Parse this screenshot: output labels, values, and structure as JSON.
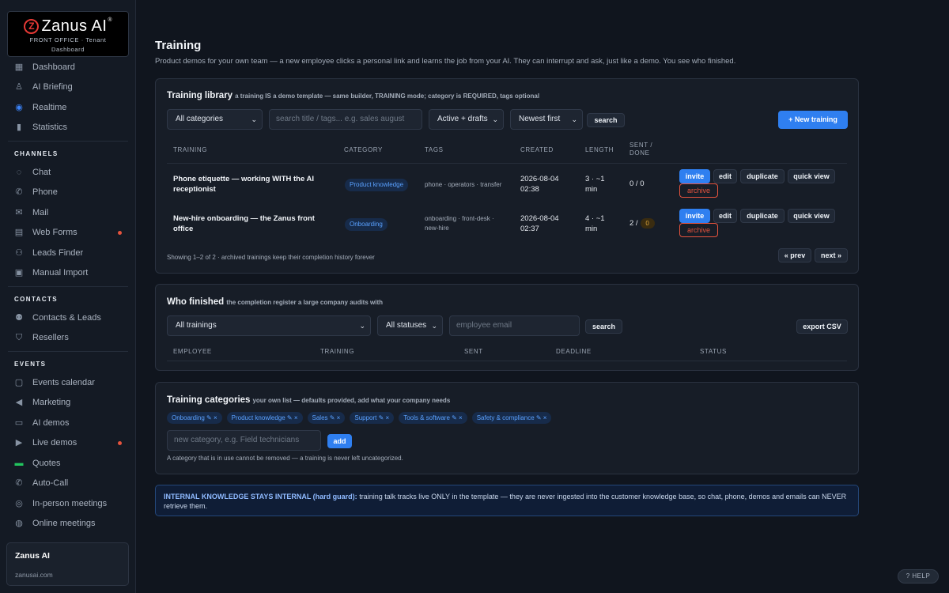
{
  "brand": {
    "logo_letter": "Z",
    "logo_text": "Zanus AI",
    "logo_reg": "®",
    "subtitle_line1": "FRONT OFFICE · Tenant",
    "subtitle_line2": "Dashboard"
  },
  "sidebar": {
    "top_items": [
      {
        "label": "Dashboard",
        "icon": "grid-icon"
      },
      {
        "label": "AI Briefing",
        "icon": "person-wave-icon"
      },
      {
        "label": "Realtime",
        "icon": "globe-icon"
      },
      {
        "label": "Statistics",
        "icon": "bar-chart-icon"
      }
    ],
    "channels_heading": "CHANNELS",
    "channels": [
      {
        "label": "Chat",
        "icon": "chat-bubble-icon"
      },
      {
        "label": "Phone",
        "icon": "phone-icon"
      },
      {
        "label": "Mail",
        "icon": "mail-icon"
      },
      {
        "label": "Web Forms",
        "icon": "form-icon",
        "dot": true
      },
      {
        "label": "Leads Finder",
        "icon": "people-icon"
      },
      {
        "label": "Manual Import",
        "icon": "import-icon"
      }
    ],
    "contacts_heading": "CONTACTS",
    "contacts": [
      {
        "label": "Contacts & Leads",
        "icon": "contacts-icon"
      },
      {
        "label": "Resellers",
        "icon": "handshake-icon"
      }
    ],
    "events_heading": "EVENTS",
    "events": [
      {
        "label": "Events calendar",
        "icon": "calendar-icon"
      },
      {
        "label": "Marketing",
        "icon": "megaphone-icon"
      },
      {
        "label": "AI demos",
        "icon": "monitor-icon"
      },
      {
        "label": "Live demos",
        "icon": "video-icon",
        "dot": true
      },
      {
        "label": "Quotes",
        "icon": "quote-icon"
      },
      {
        "label": "Auto-Call",
        "icon": "auto-call-icon"
      },
      {
        "label": "In-person meetings",
        "icon": "location-pin-icon"
      },
      {
        "label": "Online meetings",
        "icon": "online-meeting-icon"
      }
    ],
    "tenant_name": "Zanus AI",
    "tenant_url": "zanusai.com"
  },
  "page": {
    "title": "Training",
    "description": "Product demos for your own team — a new employee clicks a personal link and learns the job from your AI. They can interrupt and ask, just like a demo. You see who finished."
  },
  "library": {
    "title": "Training library",
    "subtitle": "a training IS a demo template — same builder, TRAINING mode; category is REQUIRED, tags optional",
    "category_filter": "All categories",
    "search_placeholder": "search title / tags... e.g. sales august",
    "status_filter": "Active + drafts",
    "sort": "Newest first",
    "search_button": "search",
    "new_button": "+ New training",
    "columns": {
      "training": "TRAINING",
      "category": "CATEGORY",
      "tags": "TAGS",
      "created": "CREATED",
      "length": "LENGTH",
      "sent_line1": "SENT /",
      "sent_line2": "DONE"
    },
    "rows": [
      {
        "title_line1": "Phone etiquette — working WITH the AI",
        "title_line2": "receptionist",
        "category": "Product knowledge",
        "tags": "phone · operators · transfer",
        "tags_line2": "",
        "created_date": "2026-08-04",
        "created_time": "02:38",
        "length_line1": "3 · ~1",
        "length_line2": "min",
        "sent_done": "0 / 0",
        "done_badge": ""
      },
      {
        "title_line1": "New-hire onboarding — the Zanus front",
        "title_line2": "office",
        "category": "Onboarding",
        "tags": "onboarding · front-desk ·",
        "tags_line2": "new-hire",
        "created_date": "2026-08-04",
        "created_time": "02:37",
        "length_line1": "4 · ~1",
        "length_line2": "min",
        "sent_done": "2 /",
        "done_badge": "0"
      }
    ],
    "actions": {
      "invite": "invite",
      "edit": "edit",
      "duplicate": "duplicate",
      "quick_view": "quick view",
      "archive": "archive"
    },
    "footer": "Showing 1–2 of 2 · archived trainings keep their completion history forever",
    "prev": "« prev",
    "next": "next »"
  },
  "finished": {
    "title": "Who finished",
    "subtitle": "the completion register a large company audits with",
    "training_filter": "All trainings",
    "status_filter": "All statuses",
    "email_placeholder": "employee email",
    "search_button": "search",
    "export_button": "export CSV",
    "columns": {
      "employee": "EMPLOYEE",
      "training": "TRAINING",
      "sent": "SENT",
      "deadline": "DEADLINE",
      "status": "STATUS"
    }
  },
  "categories": {
    "title": "Training categories",
    "subtitle": "your own list — defaults provided, add what your company needs",
    "chips": [
      "Onboarding ✎ ×",
      "Product knowledge ✎ ×",
      "Sales ✎ ×",
      "Support ✎ ×",
      "Tools & software ✎ ×",
      "Safety & compliance ✎ ×"
    ],
    "new_placeholder": "new category, e.g. Field technicians",
    "add_button": "add",
    "note": "A category that is in use cannot be removed — a training is never left uncategorized."
  },
  "guard": {
    "strong": "INTERNAL KNOWLEDGE STAYS INTERNAL (hard guard):",
    "text": " training talk tracks live ONLY in the template — they are never ingested into the customer knowledge base, so chat, phone, demos and emails can NEVER retrieve them."
  },
  "help": "? HELP"
}
